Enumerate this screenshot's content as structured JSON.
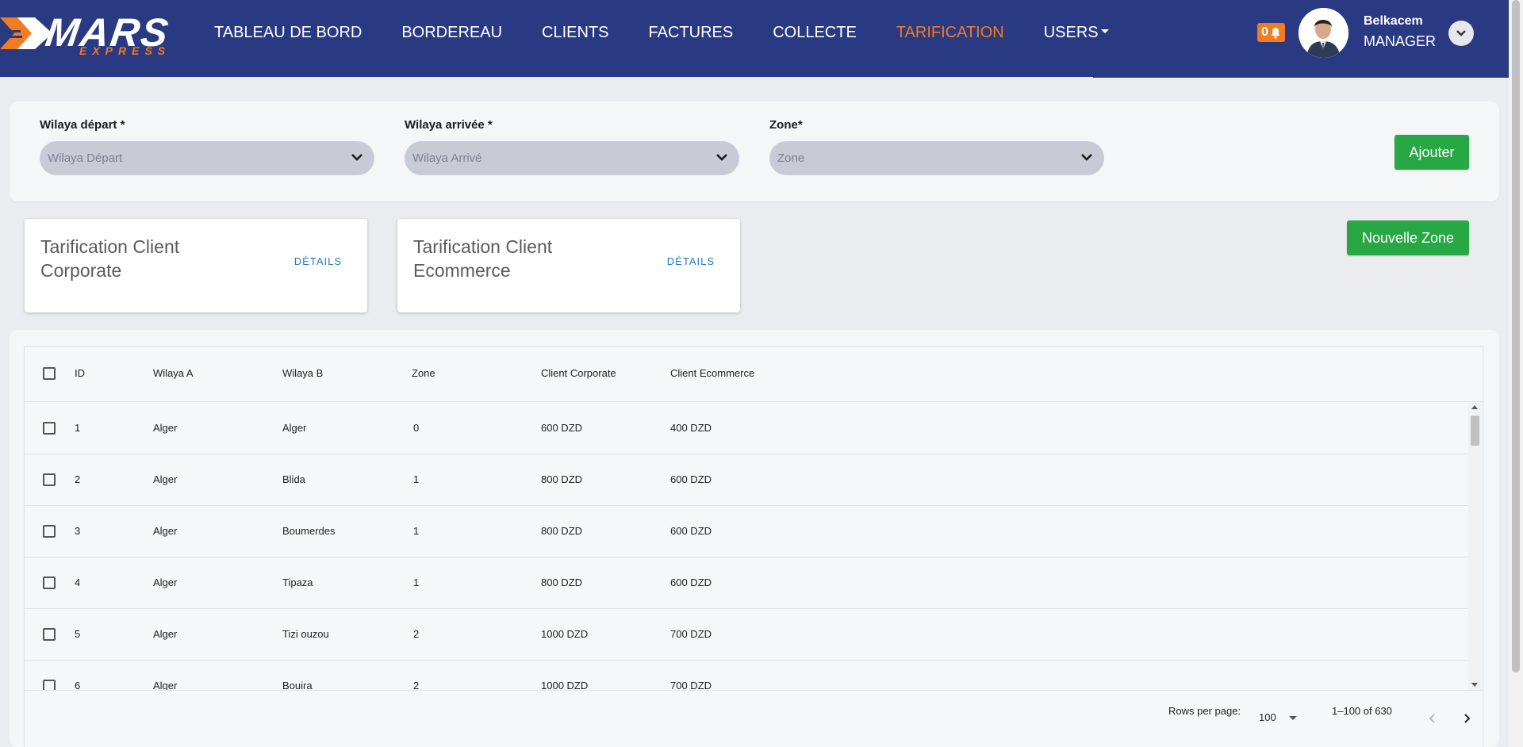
{
  "brand": {
    "name": "MARS",
    "tagline": "EXPRESS"
  },
  "nav": {
    "items": [
      {
        "label": "TABLEAU DE BORD",
        "name": "nav-tableau-de-bord"
      },
      {
        "label": "BORDEREAU",
        "name": "nav-bordereau"
      },
      {
        "label": "CLIENTS",
        "name": "nav-clients"
      },
      {
        "label": "FACTURES",
        "name": "nav-factures"
      },
      {
        "label": "COLLECTE",
        "name": "nav-collecte"
      },
      {
        "label": "TARIFICATION",
        "name": "nav-tarification",
        "active": true
      },
      {
        "label": "USERS",
        "name": "nav-users",
        "dropdown": true
      }
    ],
    "notification_count": "0",
    "user": {
      "name": "Belkacem",
      "role": "MANAGER"
    }
  },
  "filters": {
    "wilaya_depart": {
      "label": "Wilaya départ *",
      "placeholder": "Wilaya Départ"
    },
    "wilaya_arrivee": {
      "label": "Wilaya arrivée *",
      "placeholder": "Wilaya Arrivé"
    },
    "zone": {
      "label": "Zone*",
      "placeholder": "Zone"
    },
    "add_label": "Ajouter"
  },
  "cards": [
    {
      "title": "Tarification Client Corporate",
      "link": "DÉTAILS"
    },
    {
      "title": "Tarification Client Ecommerce",
      "link": "DÉTAILS"
    }
  ],
  "new_zone_label": "Nouvelle Zone",
  "table": {
    "columns": [
      "ID",
      "Wilaya A",
      "Wilaya B",
      "Zone",
      "Client Corporate",
      "Client Ecommerce"
    ],
    "rows": [
      [
        "1",
        "Alger",
        "Alger",
        "0",
        "600 DZD",
        "400 DZD"
      ],
      [
        "2",
        "Alger",
        "Blida",
        "1",
        "800 DZD",
        "600 DZD"
      ],
      [
        "3",
        "Alger",
        "Boumerdes",
        "1",
        "800 DZD",
        "600 DZD"
      ],
      [
        "4",
        "Alger",
        "Tipaza",
        "1",
        "800 DZD",
        "600 DZD"
      ],
      [
        "5",
        "Alger",
        "Tizi ouzou",
        "2",
        "1000 DZD",
        "700 DZD"
      ],
      [
        "6",
        "Alger",
        "Bouira",
        "2",
        "1000 DZD",
        "700 DZD"
      ]
    ],
    "rows_per_page_label": "Rows per page:",
    "rows_per_page": "100",
    "range": "1–100 of 630"
  },
  "colors": {
    "navbar": "#2a3a82",
    "accent": "#f47b20",
    "green": "#28a745",
    "link": "#1f78c8"
  },
  "icons": {
    "notification": "bell-icon",
    "select": "chevron-down-icon",
    "user_toggle": "chevron-down-icon",
    "prev": "chevron-left-icon",
    "next": "chevron-right-icon"
  }
}
